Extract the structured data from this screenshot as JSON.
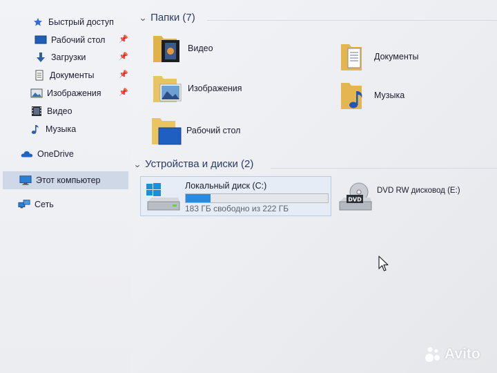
{
  "nav": {
    "quick_access": "Быстрый доступ",
    "items": [
      {
        "label": "Рабочий стол",
        "pinned": true
      },
      {
        "label": "Загрузки",
        "pinned": true
      },
      {
        "label": "Документы",
        "pinned": true
      },
      {
        "label": "Изображения",
        "pinned": true
      },
      {
        "label": "Видео",
        "pinned": false
      },
      {
        "label": "Музыка",
        "pinned": false
      }
    ],
    "onedrive": "OneDrive",
    "this_pc": "Этот компьютер",
    "network": "Сеть"
  },
  "folders": {
    "header": "Папки (7)",
    "items": [
      "Видео",
      "Документы",
      "Изображения",
      "Музыка",
      "Рабочий стол"
    ]
  },
  "devices": {
    "header": "Устройства и диски (2)",
    "local_disk": {
      "name": "Локальный диск (C:)",
      "free_text": "183 ГБ свободно из 222 ГБ",
      "used_fraction": 0.176
    },
    "dvd": {
      "name": "DVD RW дисковод (E:)",
      "badge": "DVD"
    }
  },
  "watermark": "Avito",
  "colors": {
    "accent": "#2a8ae0",
    "header_text": "#2a3b63",
    "selection": "#cfd8e6",
    "folder": "#f0c75e"
  }
}
